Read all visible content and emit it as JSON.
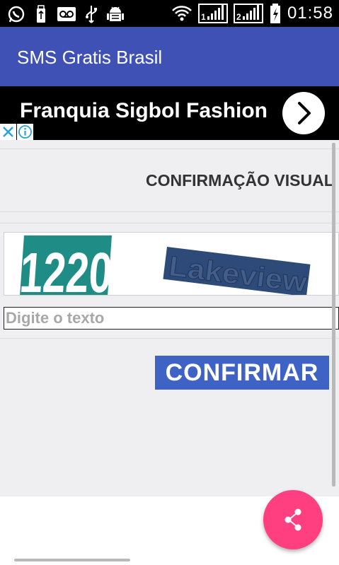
{
  "status_bar": {
    "time": "01:58",
    "sim1_label": "1",
    "sim2_label": "2",
    "icons": [
      "whatsapp-icon",
      "usb-icon",
      "voicemail-icon",
      "usb-debug-icon",
      "android-debug-icon",
      "wifi-icon",
      "signal-icon",
      "battery-charging-icon"
    ]
  },
  "app_bar": {
    "title": "SMS Gratis Brasil"
  },
  "ad": {
    "title": "Franquia Sigbol Fashion",
    "close_icon": "close-icon",
    "info_icon": "info-icon",
    "arrow_icon": "chevron-right-icon"
  },
  "captcha": {
    "title": "CONFIRMAÇÃO VISUAL",
    "image_words": [
      "1220",
      "Lakeview"
    ],
    "input_placeholder": "Digite o texto",
    "input_value": "",
    "confirm_label": "CONFIRMAR"
  },
  "fab": {
    "icon": "share-icon"
  },
  "colors": {
    "app_bar": "#3f51b5",
    "confirm_button": "#3f63c4",
    "fab": "#ff3f80",
    "captcha_teal": "#1f8d86",
    "captcha_navy": "#2e4a78"
  }
}
